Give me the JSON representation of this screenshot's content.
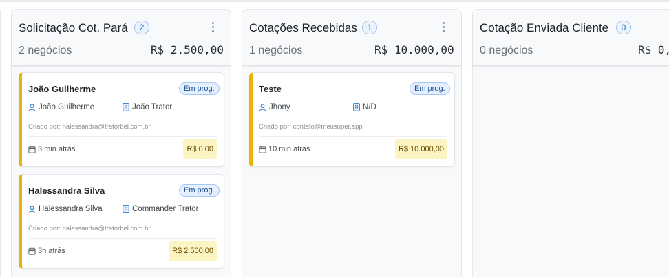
{
  "columns": [
    {
      "title": "Solicitação Cot. Pará",
      "badge": "2",
      "count_text": "2 negócios",
      "total": "R$ 2.500,00",
      "cards": [
        {
          "title": "João Guilherme",
          "status": "Em prog.",
          "contact": "João Guilherme",
          "company": "João Trator",
          "created_by": "Criado por: halessandra@tratorbel.com.br",
          "time": "3 min atrás",
          "value": "R$ 0,00"
        },
        {
          "title": "Halessandra Silva",
          "status": "Em prog.",
          "contact": "Halessandra Silva",
          "company": "Commander Trator",
          "created_by": "Criado por: halessandra@tratorbel.com.br",
          "time": "3h atrás",
          "value": "R$ 2.500,00"
        }
      ]
    },
    {
      "title": "Cotações Recebidas",
      "badge": "1",
      "count_text": "1 negócios",
      "total": "R$ 10.000,00",
      "cards": [
        {
          "title": "Teste",
          "status": "Em prog.",
          "contact": "Jhony",
          "company": "N/D",
          "created_by": "Criado por: contato@meusuper.app",
          "time": "10 min atrás",
          "value": "R$ 10.000,00"
        }
      ]
    },
    {
      "title": "Cotação Enviada Cliente",
      "badge": "0",
      "count_text": "0 negócios",
      "total": "R$ 0,",
      "cards": []
    }
  ],
  "icons": {
    "menu": "kebab-menu-icon",
    "contact": "user-icon",
    "company": "building-icon",
    "time": "calendar-icon"
  },
  "colors": {
    "card_accent": "#eab308",
    "badge_blue": "#2a6fbf",
    "value_bg": "#fdf4c4"
  }
}
